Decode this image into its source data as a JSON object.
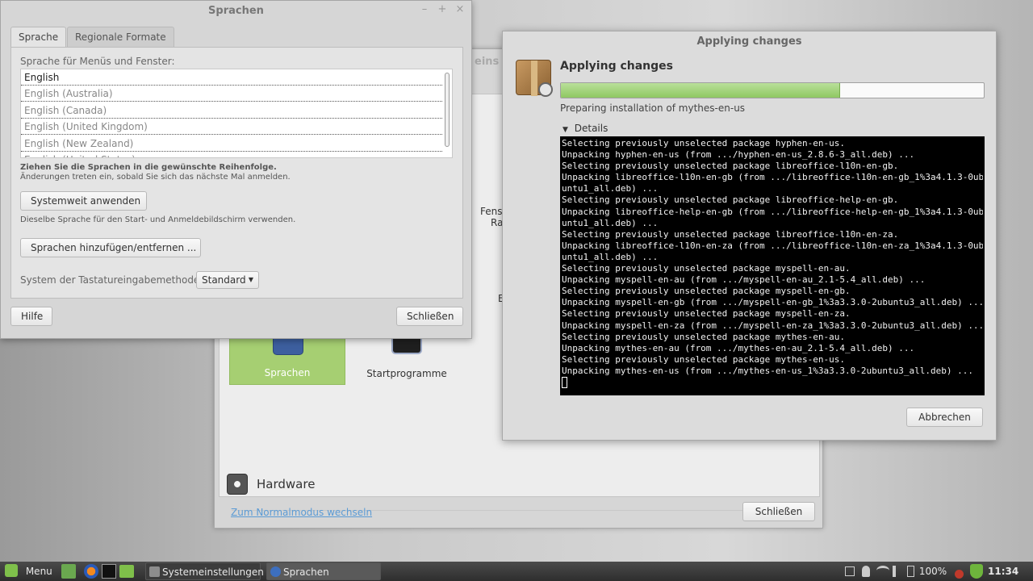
{
  "colors": {
    "accent_green": "#8fc862",
    "link_blue": "#5b9bd5",
    "terminal_bg": "#000000"
  },
  "system_settings": {
    "title_partial": "eins",
    "tiles": [
      {
        "label": "Sprachen",
        "icon": "globe-icon",
        "active": true
      },
      {
        "label": "Startprogramme",
        "icon": "startup-icon",
        "active": false
      }
    ],
    "peek_texts": [
      "Fenst",
      "Ra",
      "E"
    ],
    "category": {
      "label": "Hardware",
      "icon": "hardware-icon"
    },
    "mode_link": "Zum Normalmodus wechseln",
    "close_label": "Schließen"
  },
  "sprachen": {
    "title": "Sprachen",
    "controls": {
      "minimize": "–",
      "maximize": "+",
      "close": "×"
    },
    "tabs": [
      {
        "label": "Sprache",
        "active": true
      },
      {
        "label": "Regionale Formate",
        "active": false
      }
    ],
    "list_label": "Sprache für Menüs und Fenster:",
    "languages": [
      "English",
      "English (Australia)",
      "English (Canada)",
      "English (United Kingdom)",
      "English (New Zealand)",
      "English (United States)"
    ],
    "hint_bold": "Ziehen Sie die Sprachen in die gewünschte Reihenfolge.",
    "hint_small": "Änderungen treten ein, sobald Sie sich das nächste Mal anmelden.",
    "apply_system_label": "Systemweit anwenden",
    "apply_system_hint": "Dieselbe Sprache für den Start- und Anmeldebildschirm verwenden.",
    "add_remove_label": "Sprachen hinzufügen/entfernen ...",
    "input_method_label": "System der Tastatureingabemethode:",
    "input_method_value": "Standard",
    "help_label": "Hilfe",
    "close_label": "Schließen"
  },
  "applying": {
    "window_title": "Applying changes",
    "heading": "Applying changes",
    "progress": 0.66,
    "status": "Preparing installation of mythes-en-us",
    "details_label": "Details",
    "terminal_lines": [
      "Selecting previously unselected package hyphen-en-us.",
      "Unpacking hyphen-en-us (from .../hyphen-en-us_2.8.6-3_all.deb) ...",
      "Selecting previously unselected package libreoffice-l10n-en-gb.",
      "Unpacking libreoffice-l10n-en-gb (from .../libreoffice-l10n-en-gb_1%3a4.1.3-0ub",
      "untu1_all.deb) ...",
      "Selecting previously unselected package libreoffice-help-en-gb.",
      "Unpacking libreoffice-help-en-gb (from .../libreoffice-help-en-gb_1%3a4.1.3-0ub",
      "untu1_all.deb) ...",
      "Selecting previously unselected package libreoffice-l10n-en-za.",
      "Unpacking libreoffice-l10n-en-za (from .../libreoffice-l10n-en-za_1%3a4.1.3-0ub",
      "untu1_all.deb) ...",
      "Selecting previously unselected package myspell-en-au.",
      "Unpacking myspell-en-au (from .../myspell-en-au_2.1-5.4_all.deb) ...",
      "Selecting previously unselected package myspell-en-gb.",
      "Unpacking myspell-en-gb (from .../myspell-en-gb_1%3a3.3.0-2ubuntu3_all.deb) ...",
      "Selecting previously unselected package myspell-en-za.",
      "Unpacking myspell-en-za (from .../myspell-en-za_1%3a3.3.0-2ubuntu3_all.deb) ...",
      "Selecting previously unselected package mythes-en-au.",
      "Unpacking mythes-en-au (from .../mythes-en-au_2.1-5.4_all.deb) ...",
      "Selecting previously unselected package mythes-en-us.",
      "Unpacking mythes-en-us (from .../mythes-en-us_1%3a3.3.0-2ubuntu3_all.deb) ..."
    ],
    "cancel_label": "Abbrechen"
  },
  "taskbar": {
    "menu_label": "Menu",
    "windows": [
      {
        "label": "Systemeinstellungen",
        "active": false
      },
      {
        "label": "Sprachen",
        "active": true
      }
    ],
    "battery": "100%",
    "clock": "11:34"
  }
}
